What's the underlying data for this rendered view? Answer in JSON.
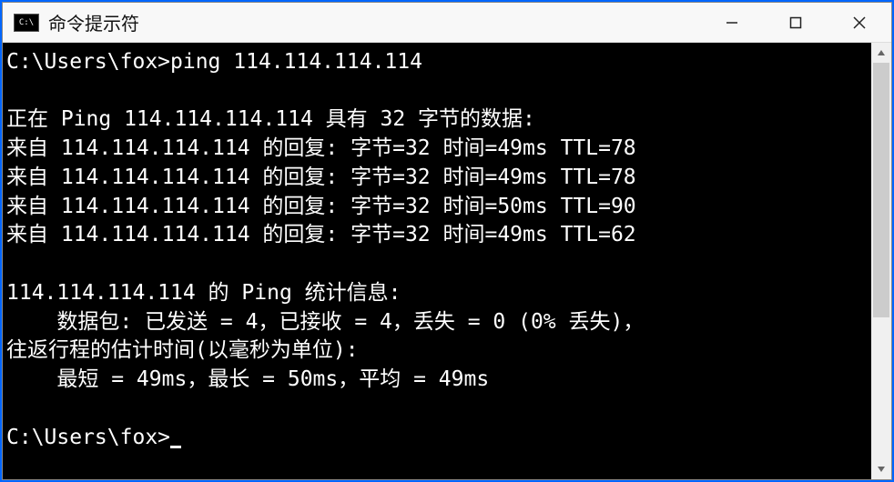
{
  "window": {
    "title": "命令提示符"
  },
  "terminal": {
    "prompt1": "C:\\Users\\fox>",
    "command1": "ping 114.114.114.114",
    "blank1": "",
    "pinging": "正在 Ping 114.114.114.114 具有 32 字节的数据:",
    "reply1": "来自 114.114.114.114 的回复: 字节=32 时间=49ms TTL=78",
    "reply2": "来自 114.114.114.114 的回复: 字节=32 时间=49ms TTL=78",
    "reply3": "来自 114.114.114.114 的回复: 字节=32 时间=50ms TTL=90",
    "reply4": "来自 114.114.114.114 的回复: 字节=32 时间=49ms TTL=62",
    "blank2": "",
    "stats_header": "114.114.114.114 的 Ping 统计信息:",
    "stats_packets": "    数据包: 已发送 = 4，已接收 = 4，丢失 = 0 (0% 丢失)，",
    "rtt_header": "往返行程的估计时间(以毫秒为单位):",
    "rtt_values": "    最短 = 49ms，最长 = 50ms，平均 = 49ms",
    "blank3": "",
    "prompt2": "C:\\Users\\fox>"
  }
}
